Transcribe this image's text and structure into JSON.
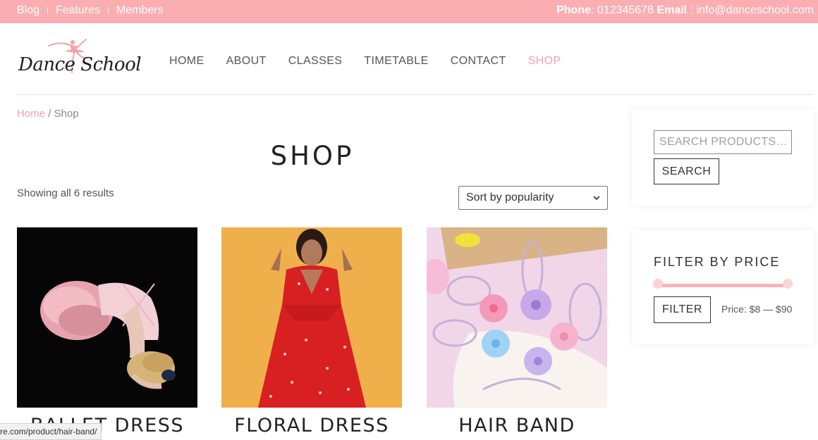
{
  "topbar": {
    "links": [
      "Blog",
      "Features",
      "Members"
    ],
    "separator": "|",
    "phone_label": "Phone",
    "phone_value": ": 012345678 ",
    "email_label": "Email",
    "email_value": " : info@danceschool.com"
  },
  "logo": {
    "text": "Dance School"
  },
  "nav": {
    "items": [
      "HOME",
      "ABOUT",
      "CLASSES",
      "TIMETABLE",
      "CONTACT",
      "SHOP"
    ],
    "active": "SHOP"
  },
  "breadcrumb": {
    "home": "Home",
    "separator": " / ",
    "current": "Shop"
  },
  "page": {
    "title": "SHOP",
    "result_count": "Showing all 6 results",
    "sort_selected": "Sort by popularity"
  },
  "products": [
    {
      "name": "BALLET DRESS"
    },
    {
      "name": "FLORAL DRESS"
    },
    {
      "name": "HAIR BAND"
    }
  ],
  "sidebar": {
    "search_placeholder": "SEARCH PRODUCTS…",
    "search_button": "SEARCH",
    "filter_title": "FILTER BY PRICE",
    "filter_button": "FILTER",
    "price_label": "Price: $8 — $90",
    "price_min_fraction": 0,
    "price_max_fraction": 1
  },
  "status": {
    "url": "re.com/product/hair-band/"
  },
  "colors": {
    "accent": "#fbaeb2",
    "active_nav": "#f0a3a8"
  }
}
